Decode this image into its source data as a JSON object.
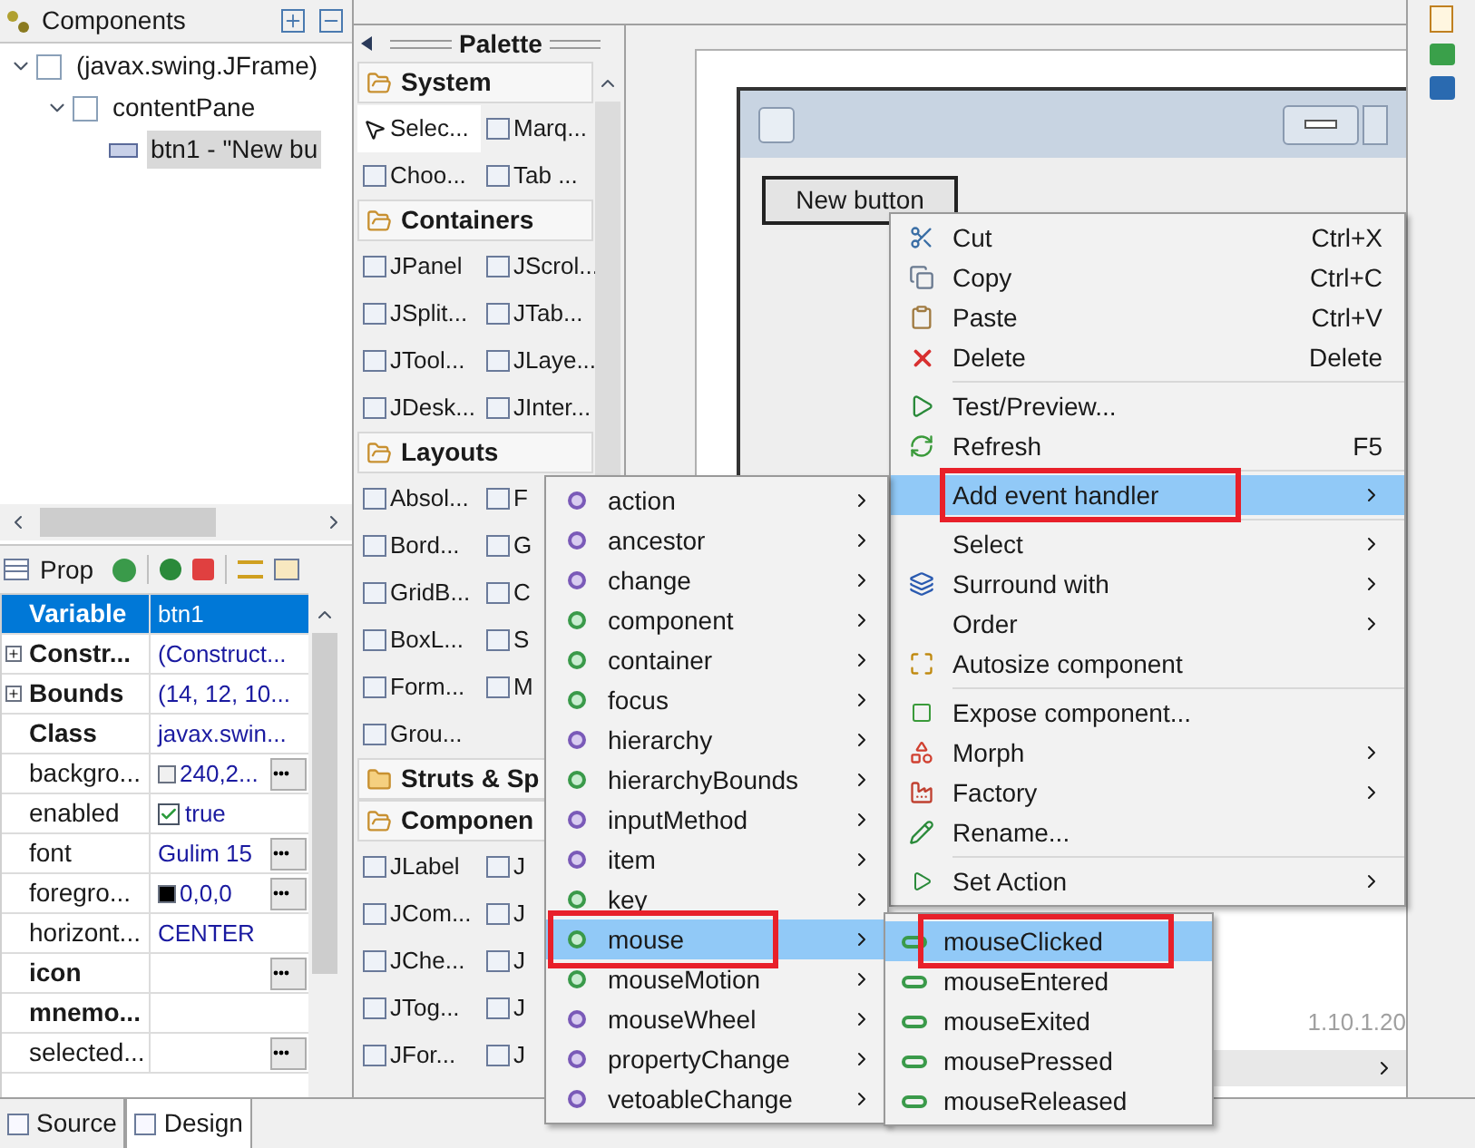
{
  "components": {
    "title": "Components",
    "tree": [
      {
        "label": "(javax.swing.JFrame)",
        "expanded": true,
        "selected": false,
        "children": [
          {
            "label": "contentPane",
            "expanded": true,
            "selected": false,
            "children": [
              {
                "label": "btn1 - \"New bu",
                "selected": true
              }
            ]
          }
        ]
      }
    ]
  },
  "properties": {
    "title": "Prop",
    "rows": [
      {
        "name": "Variable",
        "value": "btn1",
        "bold": true,
        "expandable": false,
        "button": false,
        "selected": true
      },
      {
        "name": "Constr...",
        "value": "(Construct...",
        "bold": true,
        "expandable": true,
        "button": false,
        "selected": false
      },
      {
        "name": "Bounds",
        "value": "(14, 12, 10...",
        "bold": true,
        "expandable": true,
        "button": false,
        "selected": false
      },
      {
        "name": "Class",
        "value": "javax.swin...",
        "bold": true,
        "expandable": false,
        "button": false,
        "selected": false
      },
      {
        "name": "backgro...",
        "value": "240,2...",
        "kind": "color",
        "color": "#f0f0f0",
        "bold": false,
        "expandable": false,
        "button": true,
        "selected": false
      },
      {
        "name": "enabled",
        "value": "true",
        "kind": "check",
        "checked": true,
        "bold": false,
        "expandable": false,
        "button": false,
        "selected": false
      },
      {
        "name": "font",
        "value": "Gulim 15",
        "bold": false,
        "expandable": false,
        "button": true,
        "selected": false
      },
      {
        "name": "foregro...",
        "value": "0,0,0",
        "kind": "color",
        "color": "#000000",
        "bold": false,
        "expandable": false,
        "button": true,
        "selected": false
      },
      {
        "name": "horizont...",
        "value": "CENTER",
        "bold": false,
        "expandable": false,
        "button": false,
        "selected": false
      },
      {
        "name": "icon",
        "value": "",
        "bold": true,
        "expandable": false,
        "button": true,
        "selected": false
      },
      {
        "name": "mnemo...",
        "value": "",
        "bold": true,
        "expandable": false,
        "button": false,
        "selected": false
      },
      {
        "name": "selected...",
        "value": "",
        "bold": false,
        "expandable": false,
        "button": true,
        "selected": false
      }
    ]
  },
  "palette": {
    "title": "Palette",
    "categories": [
      {
        "label": "System",
        "expanded": true,
        "items": [
          {
            "label": "Selec...",
            "selected": true
          },
          {
            "label": "Marq...",
            "selected": false
          },
          {
            "label": "Choo...",
            "selected": false
          },
          {
            "label": "Tab ...",
            "selected": false
          }
        ]
      },
      {
        "label": "Containers",
        "expanded": true,
        "items": [
          {
            "label": "JPanel",
            "selected": false
          },
          {
            "label": "JScrol...",
            "selected": false
          },
          {
            "label": "JSplit...",
            "selected": false
          },
          {
            "label": "JTab...",
            "selected": false
          },
          {
            "label": "JTool...",
            "selected": false
          },
          {
            "label": "JLaye...",
            "selected": false
          },
          {
            "label": "JDesk...",
            "selected": false
          },
          {
            "label": "JInter...",
            "selected": false
          }
        ]
      },
      {
        "label": "Layouts",
        "expanded": true,
        "items": [
          {
            "label": "Absol...",
            "selected": false
          },
          {
            "label": "F",
            "selected": false
          },
          {
            "label": "Bord...",
            "selected": false
          },
          {
            "label": "G",
            "selected": false
          },
          {
            "label": "GridB...",
            "selected": false
          },
          {
            "label": "C",
            "selected": false
          },
          {
            "label": "BoxL...",
            "selected": false
          },
          {
            "label": "S",
            "selected": false
          },
          {
            "label": "Form...",
            "selected": false
          },
          {
            "label": "M",
            "selected": false
          },
          {
            "label": "Grou...",
            "selected": false
          }
        ]
      },
      {
        "label": "Struts & Sp",
        "expanded": false
      },
      {
        "label": "Componen",
        "expanded": true,
        "items": [
          {
            "label": "JLabel",
            "selected": false
          },
          {
            "label": "J",
            "selected": false
          },
          {
            "label": "JCom...",
            "selected": false
          },
          {
            "label": "J",
            "selected": false
          },
          {
            "label": "JChe...",
            "selected": false
          },
          {
            "label": "J",
            "selected": false
          },
          {
            "label": "JTog...",
            "selected": false
          },
          {
            "label": "J",
            "selected": false
          },
          {
            "label": "JFor...",
            "selected": false
          },
          {
            "label": "J",
            "selected": false
          }
        ]
      }
    ]
  },
  "canvas": {
    "button_label": "New button",
    "version": "1.10.1.20"
  },
  "context_menu": {
    "groups": [
      [
        {
          "label": "Cut",
          "shortcut": "Ctrl+X",
          "submenu": false,
          "selected": false
        },
        {
          "label": "Copy",
          "shortcut": "Ctrl+C",
          "submenu": false,
          "selected": false
        },
        {
          "label": "Paste",
          "shortcut": "Ctrl+V",
          "submenu": false,
          "selected": false
        },
        {
          "label": "Delete",
          "shortcut": "Delete",
          "submenu": false,
          "selected": false
        }
      ],
      [
        {
          "label": "Test/Preview...",
          "submenu": false,
          "selected": false
        },
        {
          "label": "Refresh",
          "shortcut": "F5",
          "submenu": false,
          "selected": false
        }
      ],
      [
        {
          "label": "Add event handler",
          "submenu": true,
          "selected": true,
          "marked": true
        }
      ],
      [
        {
          "label": "Select",
          "submenu": true,
          "selected": false
        },
        {
          "label": "Surround with",
          "submenu": true,
          "selected": false
        },
        {
          "label": "Order",
          "submenu": true,
          "selected": false
        },
        {
          "label": "Autosize component",
          "submenu": false,
          "selected": false
        }
      ],
      [
        {
          "label": "Expose component...",
          "submenu": false,
          "selected": false
        },
        {
          "label": "Morph",
          "submenu": true,
          "selected": false
        },
        {
          "label": "Factory",
          "submenu": true,
          "selected": false
        },
        {
          "label": "Rename...",
          "submenu": false,
          "selected": false
        }
      ],
      [
        {
          "label": "Set Action",
          "submenu": true,
          "selected": false
        }
      ]
    ]
  },
  "event_menu": {
    "items": [
      {
        "label": "action",
        "kind": "interface",
        "selected": false
      },
      {
        "label": "ancestor",
        "kind": "interface",
        "selected": false
      },
      {
        "label": "change",
        "kind": "interface",
        "selected": false
      },
      {
        "label": "component",
        "kind": "adapter",
        "selected": false
      },
      {
        "label": "container",
        "kind": "adapter",
        "selected": false
      },
      {
        "label": "focus",
        "kind": "adapter",
        "selected": false
      },
      {
        "label": "hierarchy",
        "kind": "interface",
        "selected": false
      },
      {
        "label": "hierarchyBounds",
        "kind": "adapter",
        "selected": false
      },
      {
        "label": "inputMethod",
        "kind": "interface",
        "selected": false
      },
      {
        "label": "item",
        "kind": "interface",
        "selected": false
      },
      {
        "label": "key",
        "kind": "adapter",
        "selected": false
      },
      {
        "label": "mouse",
        "kind": "adapter",
        "selected": true,
        "marked": true
      },
      {
        "label": "mouseMotion",
        "kind": "adapter",
        "selected": false
      },
      {
        "label": "mouseWheel",
        "kind": "interface",
        "selected": false
      },
      {
        "label": "propertyChange",
        "kind": "interface",
        "selected": false
      },
      {
        "label": "vetoableChange",
        "kind": "interface",
        "selected": false
      }
    ]
  },
  "mouse_menu": {
    "items": [
      {
        "label": "mouseClicked",
        "selected": true,
        "marked": true
      },
      {
        "label": "mouseEntered",
        "selected": false
      },
      {
        "label": "mouseExited",
        "selected": false
      },
      {
        "label": "mousePressed",
        "selected": false
      },
      {
        "label": "mouseReleased",
        "selected": false
      }
    ]
  },
  "bottom_tabs": [
    {
      "label": "Source",
      "selected": false
    },
    {
      "label": "Design",
      "selected": true
    }
  ]
}
